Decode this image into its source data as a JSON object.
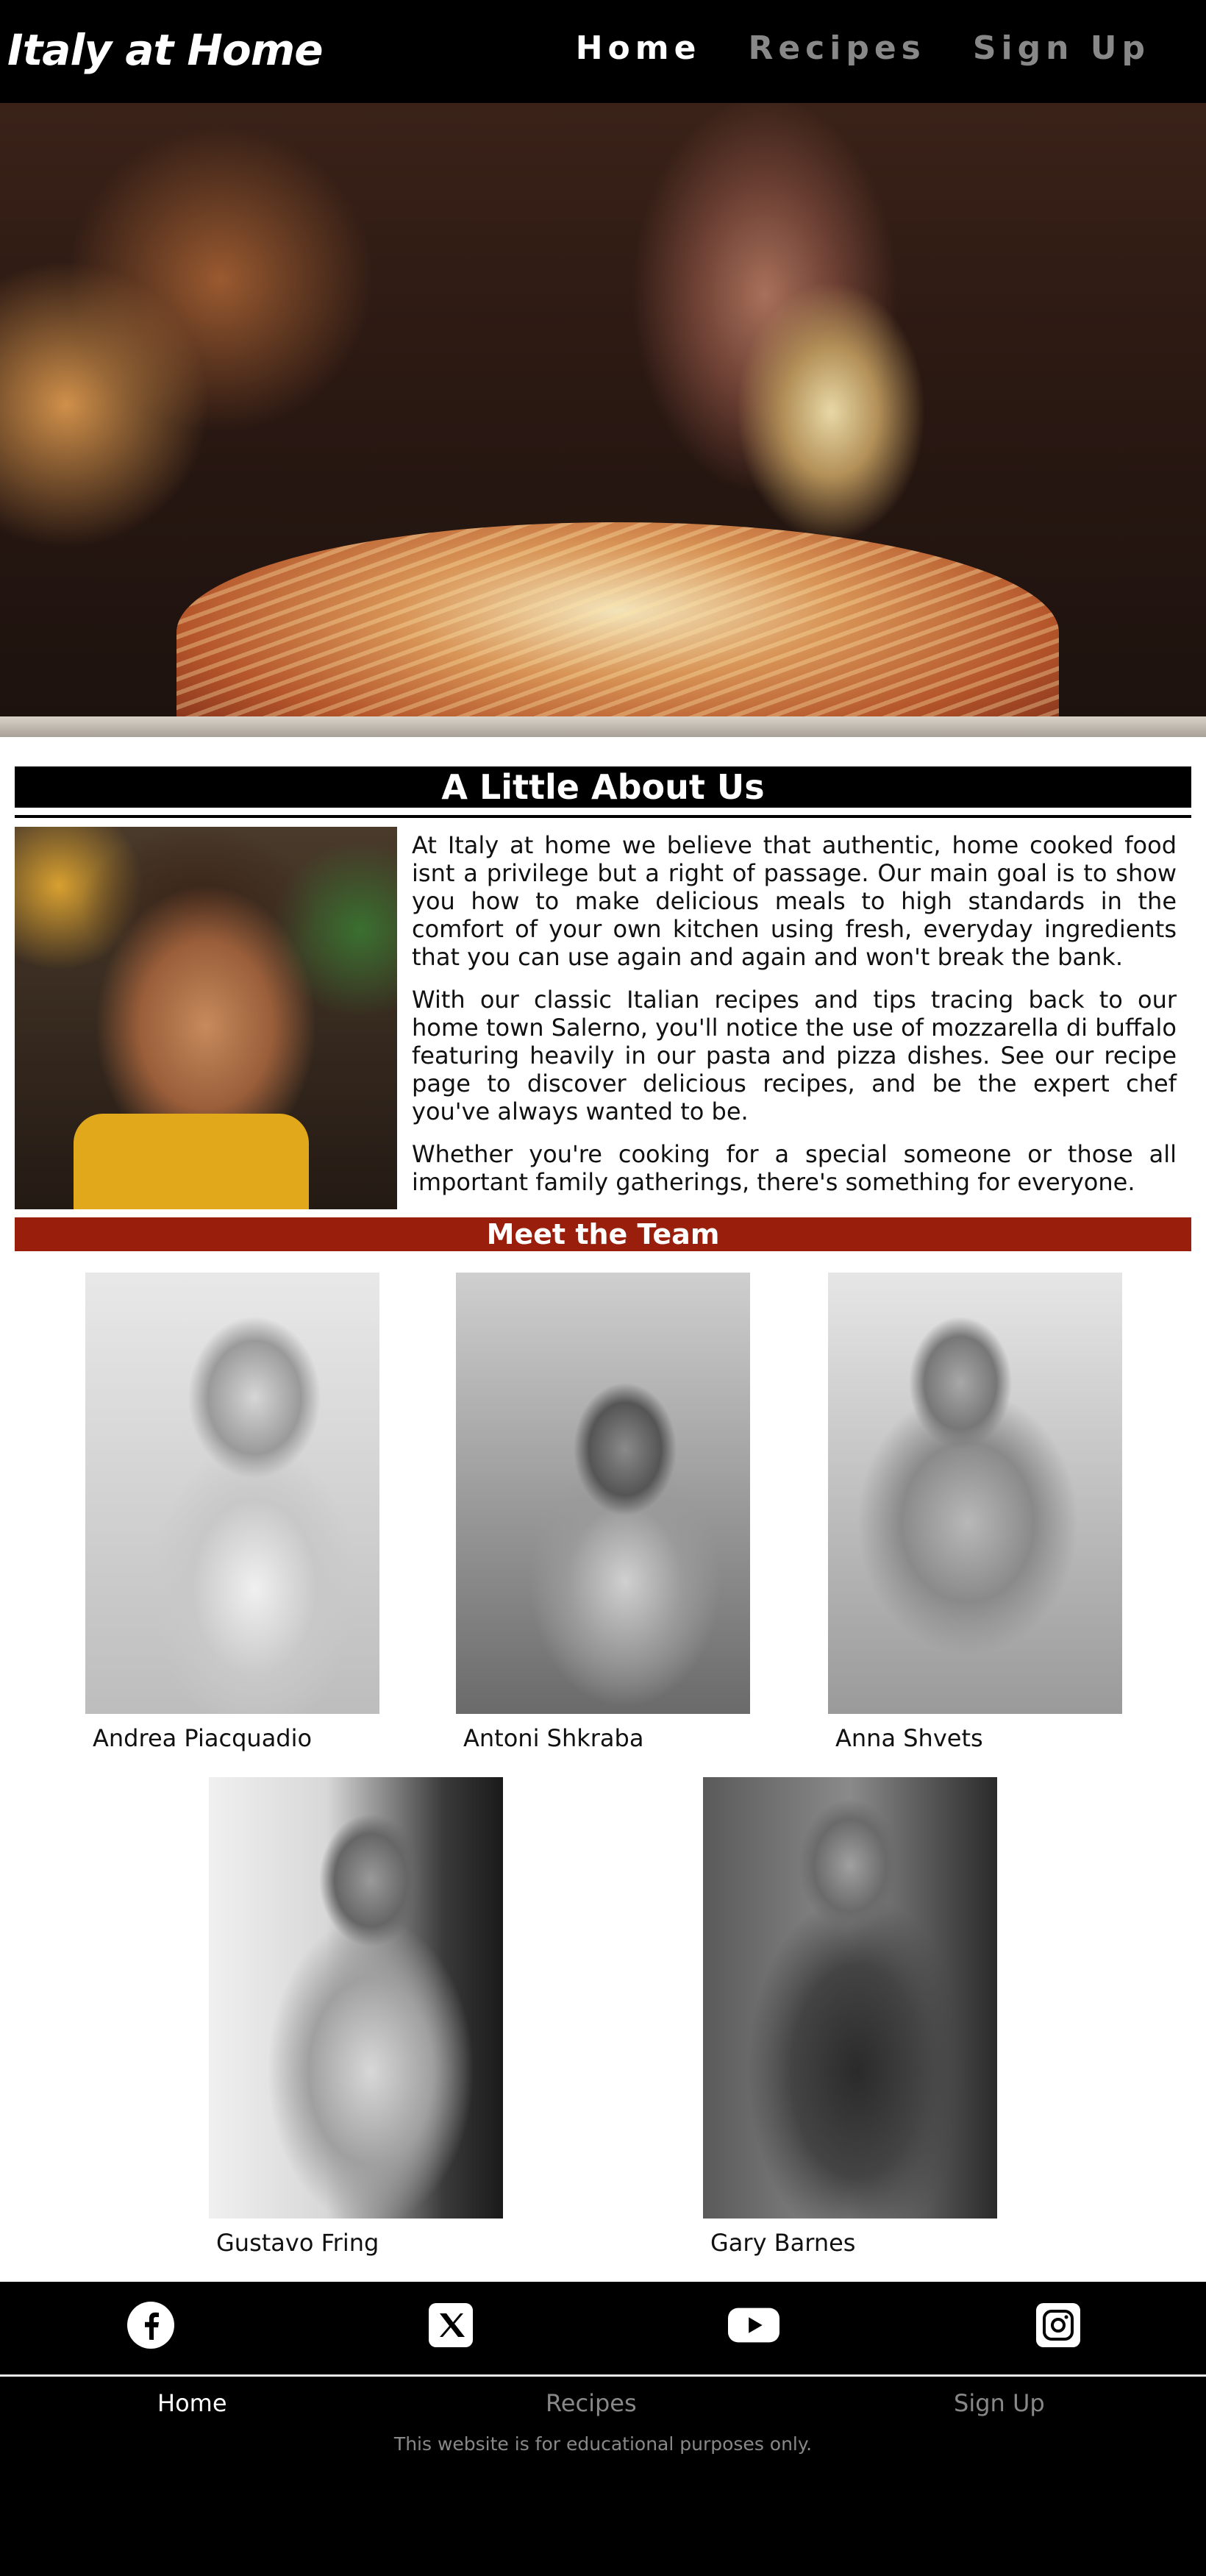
{
  "nav": {
    "brand": "Italy at Home",
    "links": [
      {
        "label": "Home",
        "active": true
      },
      {
        "label": "Recipes",
        "active": false
      },
      {
        "label": "Sign Up",
        "active": false
      }
    ]
  },
  "about": {
    "title": "A Little About Us",
    "paragraphs": [
      "At Italy at home we believe that authentic, home cooked food isnt a privilege but a right of passage. Our main goal is to show you how to make delicious meals to high standards in the comfort of your own kitchen using fresh, everyday ingredients that you can use again and again and won't break the bank.",
      "With our classic Italian recipes and tips tracing back to our home town Salerno, you'll notice the use of mozzarella di buffalo featuring heavily in our pasta and pizza dishes. See our recipe page to discover delicious recipes, and be the expert chef you've always wanted to be.",
      "Whether you're cooking for a special someone or those all important family gatherings, there's something for everyone."
    ]
  },
  "team": {
    "title": "Meet the Team",
    "members": [
      {
        "name": "Andrea Piacquadio"
      },
      {
        "name": "Antoni Shkraba"
      },
      {
        "name": "Anna Shvets"
      },
      {
        "name": "Gustavo Fring"
      },
      {
        "name": "Gary Barnes"
      }
    ]
  },
  "footer": {
    "socials": [
      "facebook-icon",
      "x-icon",
      "youtube-icon",
      "instagram-icon"
    ],
    "links": [
      {
        "label": "Home",
        "active": true
      },
      {
        "label": "Recipes",
        "active": false
      },
      {
        "label": "Sign Up",
        "active": false
      }
    ],
    "note": "This website is for educational purposes only."
  },
  "colors": {
    "nav_bg": "#000000",
    "team_banner": "#9a1e0c",
    "muted_link": "#888888"
  }
}
